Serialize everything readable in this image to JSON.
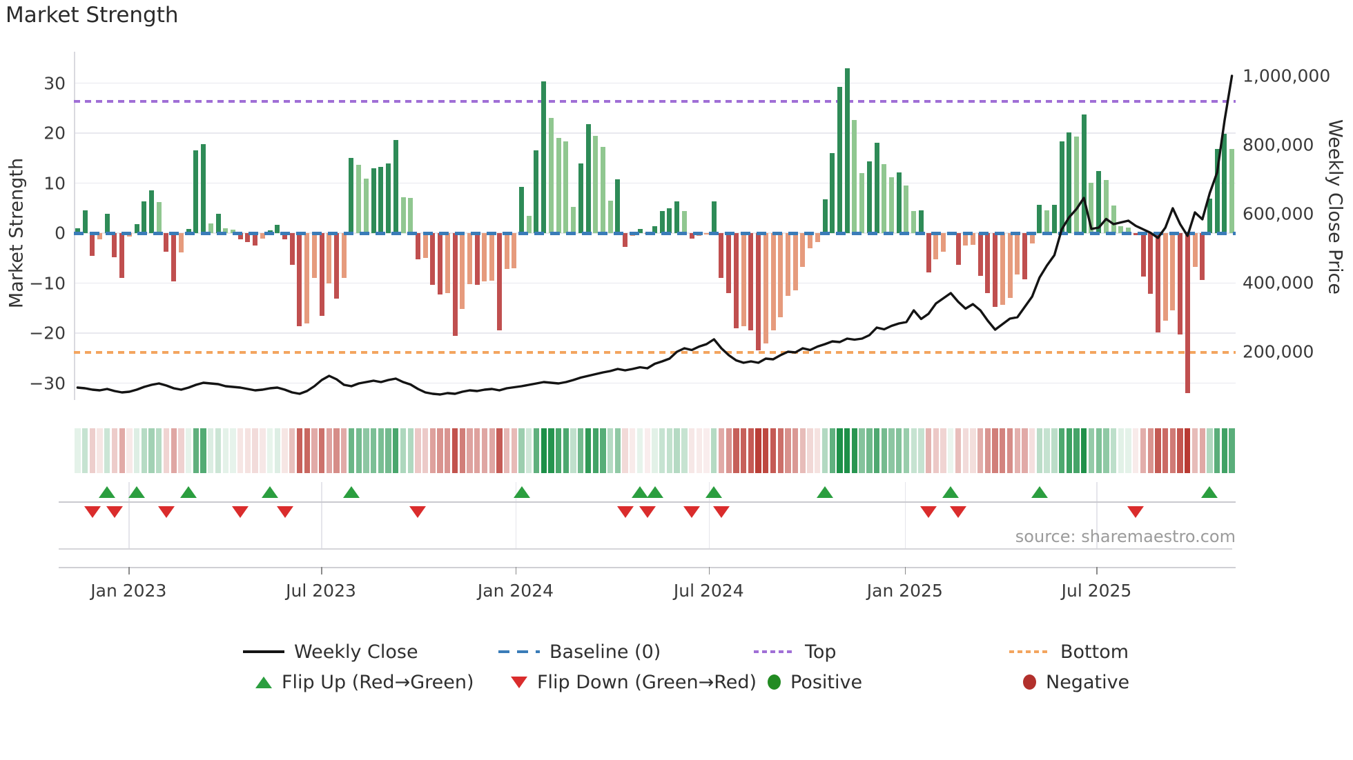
{
  "title": "Market Strength",
  "source": "source: sharemaestro.com",
  "left_axis": {
    "label": "Market Strength",
    "ticks": [
      "30",
      "20",
      "10",
      "0",
      "−10",
      "−20",
      "−30"
    ],
    "tick_values": [
      30,
      20,
      10,
      0,
      -10,
      -20,
      -30
    ]
  },
  "right_axis": {
    "label": "Weekly Close Price",
    "ticks": [
      "1,000,000",
      "800,000",
      "600,000",
      "400,000",
      "200,000"
    ],
    "tick_values": [
      1000000,
      800000,
      600000,
      400000,
      200000
    ]
  },
  "reference_lines": {
    "baseline": {
      "label": "Baseline (0)",
      "value": 0,
      "color": "#3a7cb8"
    },
    "top": {
      "label": "Top",
      "value": 26.3,
      "color": "#a06fd6"
    },
    "bottom": {
      "label": "Bottom",
      "value": -23.9,
      "color": "#f3a55f"
    }
  },
  "colors": {
    "bar_pos_rising": "#2e8b57",
    "bar_pos_falling": "#90c790",
    "bar_neg_falling": "#c04f4f",
    "bar_neg_rising": "#e69b7d",
    "price_line": "#141414",
    "flip_up": "#2b9e3f",
    "flip_down": "#da2c2c",
    "positive_dot": "#228b22",
    "negative_dot": "#b2302c",
    "heat_green": "#1d9048",
    "heat_red": "#b93a32"
  },
  "legend": {
    "rows": [
      [
        {
          "swatch": "line",
          "label": "Weekly Close"
        },
        {
          "swatch": "dash-blue",
          "label": "Baseline (0)"
        },
        {
          "swatch": "dot-purple",
          "label": "Top"
        },
        {
          "swatch": "dot-orange",
          "label": "Bottom"
        }
      ],
      [
        {
          "swatch": "triangle-up",
          "label": "Flip Up (Red→Green)"
        },
        {
          "swatch": "triangle-down",
          "label": "Flip Down (Green→Red)"
        },
        {
          "swatch": "circle-green",
          "label": "Positive"
        },
        {
          "swatch": "circle-red",
          "label": "Negative"
        }
      ]
    ]
  },
  "chart_data": {
    "type": "combo",
    "x_unit": "week",
    "x_ticks": [
      {
        "label": "Jan 2023",
        "week": 6.9
      },
      {
        "label": "Jul 2023",
        "week": 32.9
      },
      {
        "label": "Jan 2024",
        "week": 59.2
      },
      {
        "label": "Jul 2024",
        "week": 85.3
      },
      {
        "label": "Jan 2025",
        "week": 111.8
      },
      {
        "label": "Jul 2025",
        "week": 137.7
      }
    ],
    "ylim_left": [
      -33.4,
      36.3
    ],
    "ylim_right": [
      60000,
      1070000
    ],
    "grid": "horizontal",
    "legend_position": "bottom",
    "series": [
      {
        "name": "Market Strength",
        "type": "bar",
        "axis": "left",
        "values": [
          1.0,
          4.5,
          -4.5,
          -1.2,
          3.8,
          -4.8,
          -9.0,
          -0.7,
          1.8,
          6.3,
          8.5,
          6.2,
          -3.7,
          -9.7,
          -3.9,
          0.8,
          16.5,
          17.8,
          2.0,
          3.8,
          1.0,
          0.7,
          -1.2,
          -1.8,
          -2.5,
          -1.1,
          0.6,
          1.7,
          -1.2,
          -6.3,
          -18.6,
          -18.0,
          -9.0,
          -16.6,
          -10.1,
          -13.1,
          -9.0,
          15.1,
          13.7,
          10.9,
          13.0,
          13.3,
          14.0,
          18.6,
          7.2,
          7.0,
          -5.2,
          -4.9,
          -10.3,
          -12.3,
          -12.0,
          -20.5,
          -15.2,
          -10.2,
          -10.4,
          -9.7,
          -9.5,
          -19.5,
          -7.2,
          -7.1,
          9.3,
          3.5,
          16.5,
          30.4,
          23.0,
          19.1,
          18.4,
          5.3,
          14.0,
          21.8,
          19.5,
          17.2,
          6.5,
          10.7,
          -2.8,
          -0.6,
          0.8,
          -0.15,
          1.4,
          4.4,
          4.9,
          6.4,
          4.4,
          -1.1,
          -0.5,
          -0.3,
          6.4,
          -9.0,
          -12.0,
          -19.0,
          -18.6,
          -19.5,
          -23.5,
          -22.0,
          -19.5,
          -16.8,
          -12.6,
          -11.5,
          -6.7,
          -3.0,
          -1.8,
          6.7,
          16.0,
          29.3,
          33.0,
          22.6,
          12.0,
          14.3,
          18.1,
          13.8,
          11.2,
          12.1,
          9.5,
          4.4,
          4.6,
          -7.8,
          -5.3,
          -3.7,
          0.2,
          -6.4,
          -2.5,
          -2.3,
          -8.5,
          -12.0,
          -14.7,
          -14.3,
          -12.9,
          -8.3,
          -9.2,
          -2.0,
          5.7,
          4.6,
          5.7,
          18.4,
          20.2,
          19.3,
          23.7,
          10.1,
          12.4,
          10.6,
          5.5,
          1.4,
          1.1,
          -0.4,
          -8.7,
          -12.2,
          -19.8,
          -17.5,
          -15.4,
          -20.3,
          -32.0,
          -6.7,
          -9.4,
          6.9,
          16.8,
          19.8,
          16.8
        ]
      },
      {
        "name": "Weekly Close",
        "type": "line",
        "axis": "right",
        "values": [
          96000,
          94000,
          90000,
          88000,
          92000,
          86000,
          82000,
          84000,
          90000,
          98000,
          104000,
          108000,
          102000,
          94000,
          90000,
          96000,
          104000,
          110000,
          108000,
          106000,
          100000,
          98000,
          96000,
          92000,
          88000,
          90000,
          94000,
          96000,
          90000,
          82000,
          78000,
          86000,
          100000,
          118000,
          130000,
          120000,
          104000,
          100000,
          108000,
          112000,
          116000,
          112000,
          118000,
          122000,
          112000,
          105000,
          92000,
          82000,
          78000,
          76000,
          80000,
          78000,
          84000,
          88000,
          86000,
          90000,
          92000,
          88000,
          94000,
          97000,
          100000,
          104000,
          108000,
          112000,
          110000,
          108000,
          112000,
          118000,
          125000,
          130000,
          135000,
          140000,
          144000,
          150000,
          146000,
          150000,
          155000,
          152000,
          165000,
          172000,
          180000,
          200000,
          210000,
          205000,
          215000,
          222000,
          236000,
          210000,
          190000,
          175000,
          168000,
          172000,
          168000,
          180000,
          178000,
          190000,
          200000,
          198000,
          210000,
          205000,
          215000,
          222000,
          230000,
          228000,
          238000,
          235000,
          238000,
          248000,
          270000,
          265000,
          275000,
          282000,
          286000,
          320000,
          295000,
          310000,
          340000,
          355000,
          370000,
          345000,
          325000,
          338000,
          320000,
          290000,
          264000,
          280000,
          296000,
          300000,
          330000,
          360000,
          415000,
          450000,
          480000,
          555000,
          590000,
          614000,
          646000,
          556000,
          560000,
          585000,
          570000,
          575000,
          580000,
          565000,
          555000,
          545000,
          530000,
          560000,
          616000,
          570000,
          536000,
          604000,
          584000,
          660000,
          720000,
          870000,
          1000000
        ]
      }
    ],
    "flip_up_weeks": [
      4,
      8,
      15,
      26,
      37,
      60,
      76,
      78,
      86,
      101,
      118,
      130,
      153
    ],
    "flip_down_weeks": [
      2,
      5,
      12,
      22,
      28,
      46,
      74,
      77,
      83,
      87,
      115,
      119,
      143
    ],
    "heatmap": "strip below chart: one cell per week, green if bar value positive, red if negative, opacity proportional to |value|"
  }
}
